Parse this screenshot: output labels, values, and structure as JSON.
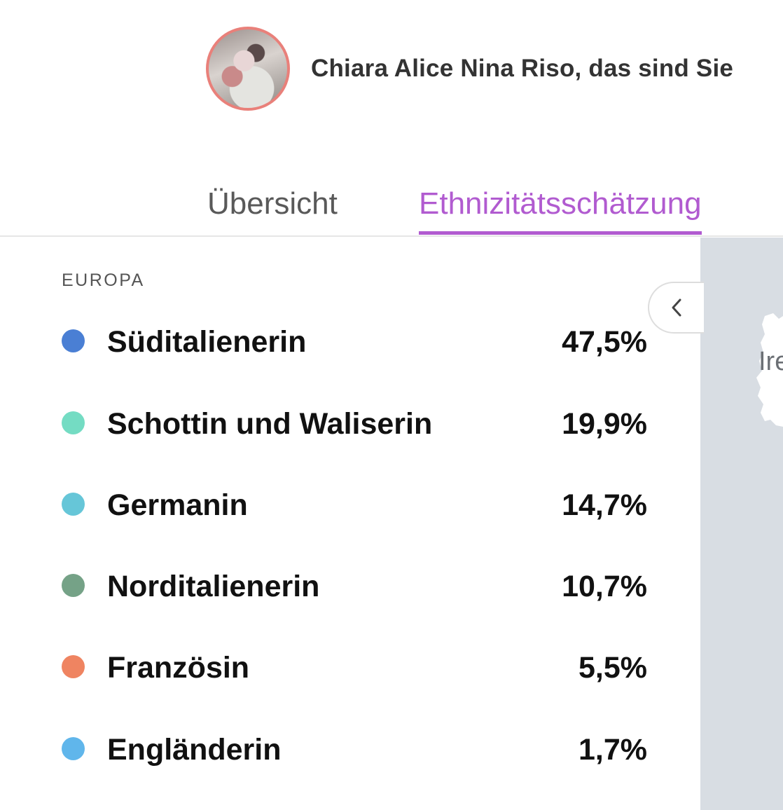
{
  "profile": {
    "name": "Chiara Alice Nina Riso, das sind Sie"
  },
  "tabs": [
    {
      "label": "Übersicht",
      "active": false
    },
    {
      "label": "Ethnizitätsschätzung",
      "active": true
    }
  ],
  "region": {
    "label": "EUROPA",
    "items": [
      {
        "label": "Süditalienerin",
        "value": "47,5%",
        "color": "#4a7fd4"
      },
      {
        "label": "Schottin und Waliserin",
        "value": "19,9%",
        "color": "#74dcc3"
      },
      {
        "label": "Germanin",
        "value": "14,7%",
        "color": "#66c6d8"
      },
      {
        "label": "Norditalienerin",
        "value": "10,7%",
        "color": "#75a287"
      },
      {
        "label": "Französin",
        "value": "5,5%",
        "color": "#ef8461"
      },
      {
        "label": "Engländerin",
        "value": "1,7%",
        "color": "#60b6eb"
      }
    ]
  },
  "map": {
    "label": "Ire",
    "collapse_icon": "chevron-left-icon"
  },
  "colors": {
    "accent": "#b15bd0",
    "avatar_border": "#e9807a",
    "map_background": "#d8dde3"
  }
}
